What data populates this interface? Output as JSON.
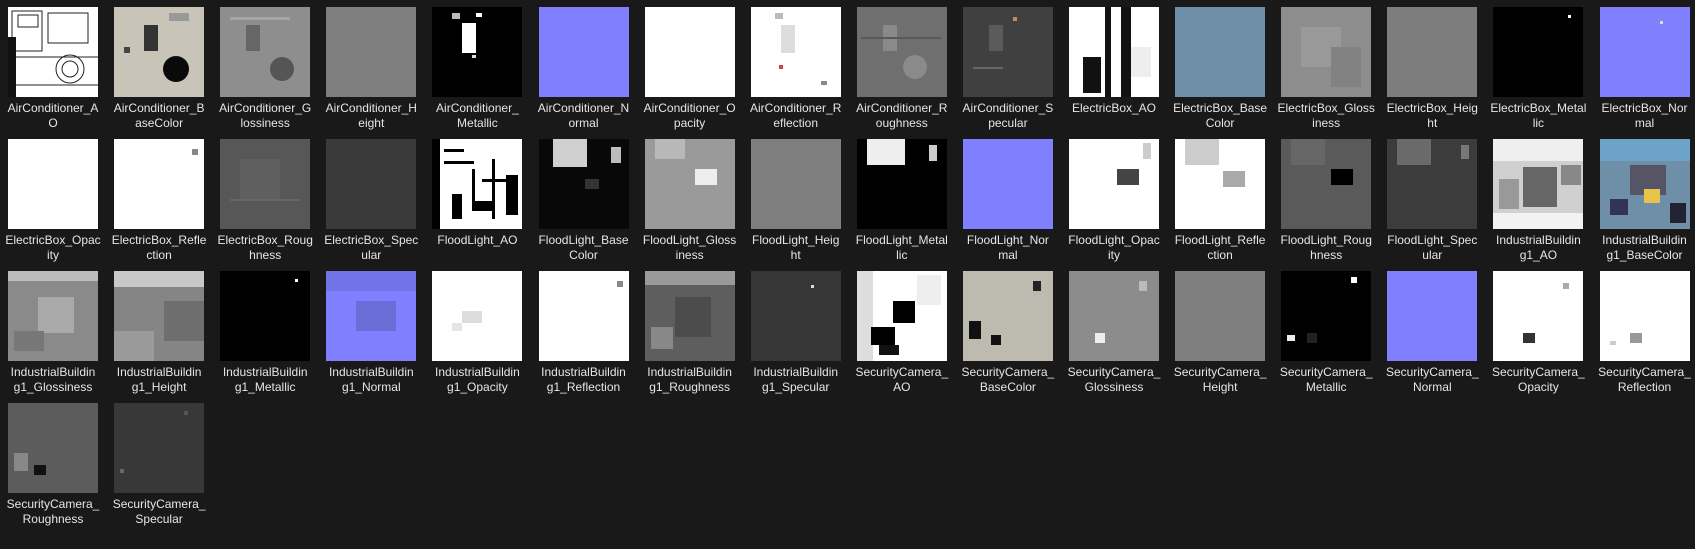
{
  "files": [
    {
      "label": "AirConditioner_A\nO",
      "icon": "texture-ao-icon",
      "bg": "#ffffff",
      "pat": "ao"
    },
    {
      "label": "AirConditioner_B\naseColor",
      "icon": "texture-basecolor-icon",
      "bg": "#c9c4b8",
      "pat": "ac-base"
    },
    {
      "label": "AirConditioner_G\nlossiness",
      "icon": "texture-glossiness-icon",
      "bg": "#8e8e8e",
      "pat": "ac-gloss"
    },
    {
      "label": "AirConditioner_H\neight",
      "icon": "texture-height-icon",
      "bg": "#7e7e7e",
      "pat": "flat"
    },
    {
      "label": "AirConditioner_\nMetallic",
      "icon": "texture-metallic-icon",
      "bg": "#000000",
      "pat": "ac-metal"
    },
    {
      "label": "AirConditioner_N\normal",
      "icon": "texture-normal-icon",
      "bg": "#8080ff",
      "pat": "flat"
    },
    {
      "label": "AirConditioner_O\npacity",
      "icon": "texture-opacity-icon",
      "bg": "#ffffff",
      "pat": "flat"
    },
    {
      "label": "AirConditioner_R\neflection",
      "icon": "texture-reflection-icon",
      "bg": "#ffffff",
      "pat": "ac-refl"
    },
    {
      "label": "AirConditioner_R\noughness",
      "icon": "texture-roughness-icon",
      "bg": "#6f6f6f",
      "pat": "ac-rough"
    },
    {
      "label": "AirConditioner_S\npecular",
      "icon": "texture-specular-icon",
      "bg": "#404040",
      "pat": "ac-spec"
    },
    {
      "label": "ElectricBox_AO",
      "icon": "texture-ao-icon",
      "bg": "#ffffff",
      "pat": "eb-ao"
    },
    {
      "label": "ElectricBox_Base\nColor",
      "icon": "texture-basecolor-icon",
      "bg": "#6d8ea6",
      "pat": "flat"
    },
    {
      "label": "ElectricBox_Gloss\niness",
      "icon": "texture-glossiness-icon",
      "bg": "#8d8d8d",
      "pat": "eb-gloss"
    },
    {
      "label": "ElectricBox_Heig\nht",
      "icon": "texture-height-icon",
      "bg": "#7d7d7d",
      "pat": "flat"
    },
    {
      "label": "ElectricBox_Metal\nlic",
      "icon": "texture-metallic-icon",
      "bg": "#000000",
      "pat": "dot"
    },
    {
      "label": "ElectricBox_Nor\nmal",
      "icon": "texture-normal-icon",
      "bg": "#8080ff",
      "pat": "dot-light"
    },
    {
      "label": "ElectricBox_Opac\nity",
      "icon": "texture-opacity-icon",
      "bg": "#ffffff",
      "pat": "flat"
    },
    {
      "label": "ElectricBox_Refle\nction",
      "icon": "texture-reflection-icon",
      "bg": "#ffffff",
      "pat": "dot-gray"
    },
    {
      "label": "ElectricBox_Roug\nhness",
      "icon": "texture-roughness-icon",
      "bg": "#575757",
      "pat": "eb-rough"
    },
    {
      "label": "ElectricBox_Spec\nular",
      "icon": "texture-specular-icon",
      "bg": "#3a3a3a",
      "pat": "flat"
    },
    {
      "label": "FloodLight_AO",
      "icon": "texture-ao-icon",
      "bg": "#ffffff",
      "pat": "fl-ao"
    },
    {
      "label": "FloodLight_Base\nColor",
      "icon": "texture-basecolor-icon",
      "bg": "#080808",
      "pat": "fl-base"
    },
    {
      "label": "FloodLight_Gloss\niness",
      "icon": "texture-glossiness-icon",
      "bg": "#9a9a9a",
      "pat": "fl-gloss"
    },
    {
      "label": "FloodLight_Heig\nht",
      "icon": "texture-height-icon",
      "bg": "#7e7e7e",
      "pat": "flat"
    },
    {
      "label": "FloodLight_Metal\nlic",
      "icon": "texture-metallic-icon",
      "bg": "#000000",
      "pat": "fl-metal"
    },
    {
      "label": "FloodLight_Nor\nmal",
      "icon": "texture-normal-icon",
      "bg": "#8080ff",
      "pat": "flat"
    },
    {
      "label": "FloodLight_Opac\nity",
      "icon": "texture-opacity-icon",
      "bg": "#ffffff",
      "pat": "fl-opac"
    },
    {
      "label": "FloodLight_Refle\nction",
      "icon": "texture-reflection-icon",
      "bg": "#ffffff",
      "pat": "fl-refl"
    },
    {
      "label": "FloodLight_Roug\nhness",
      "icon": "texture-roughness-icon",
      "bg": "#5a5a5a",
      "pat": "fl-rough"
    },
    {
      "label": "FloodLight_Spec\nular",
      "icon": "texture-specular-icon",
      "bg": "#3c3c3c",
      "pat": "fl-spec"
    },
    {
      "label": "IndustrialBuildin\ng1_AO",
      "icon": "texture-ao-icon",
      "bg": "#d0d0d0",
      "pat": "ib-ao"
    },
    {
      "label": "IndustrialBuildin\ng1_BaseColor",
      "icon": "texture-basecolor-icon",
      "bg": "#6f8fa8",
      "pat": "ib-base"
    },
    {
      "label": "IndustrialBuildin\ng1_Glossiness",
      "icon": "texture-glossiness-icon",
      "bg": "#8a8a8a",
      "pat": "ib-gloss"
    },
    {
      "label": "IndustrialBuildin\ng1_Height",
      "icon": "texture-height-icon",
      "bg": "#858585",
      "pat": "ib-height"
    },
    {
      "label": "IndustrialBuildin\ng1_Metallic",
      "icon": "texture-metallic-icon",
      "bg": "#000000",
      "pat": "dot"
    },
    {
      "label": "IndustrialBuildin\ng1_Normal",
      "icon": "texture-normal-icon",
      "bg": "#7f7fff",
      "pat": "ib-normal"
    },
    {
      "label": "IndustrialBuildin\ng1_Opacity",
      "icon": "texture-opacity-icon",
      "bg": "#ffffff",
      "pat": "ib-opac"
    },
    {
      "label": "IndustrialBuildin\ng1_Reflection",
      "icon": "texture-reflection-icon",
      "bg": "#ffffff",
      "pat": "dot-gray"
    },
    {
      "label": "IndustrialBuildin\ng1_Roughness",
      "icon": "texture-roughness-icon",
      "bg": "#5e5e5e",
      "pat": "ib-rough"
    },
    {
      "label": "IndustrialBuildin\ng1_Specular",
      "icon": "texture-specular-icon",
      "bg": "#363636",
      "pat": "dot-light"
    },
    {
      "label": "SecurityCamera_\nAO",
      "icon": "texture-ao-icon",
      "bg": "#ffffff",
      "pat": "sc-ao"
    },
    {
      "label": "SecurityCamera_\nBaseColor",
      "icon": "texture-basecolor-icon",
      "bg": "#bdbab0",
      "pat": "sc-base"
    },
    {
      "label": "SecurityCamera_\nGlossiness",
      "icon": "texture-glossiness-icon",
      "bg": "#8c8c8c",
      "pat": "sc-gloss"
    },
    {
      "label": "SecurityCamera_\nHeight",
      "icon": "texture-height-icon",
      "bg": "#7e7e7e",
      "pat": "flat"
    },
    {
      "label": "SecurityCamera_\nMetallic",
      "icon": "texture-metallic-icon",
      "bg": "#000000",
      "pat": "sc-metal"
    },
    {
      "label": "SecurityCamera_\nNormal",
      "icon": "texture-normal-icon",
      "bg": "#8080ff",
      "pat": "flat"
    },
    {
      "label": "SecurityCamera_\nOpacity",
      "icon": "texture-opacity-icon",
      "bg": "#ffffff",
      "pat": "sc-opac"
    },
    {
      "label": "SecurityCamera_\nReflection",
      "icon": "texture-reflection-icon",
      "bg": "#ffffff",
      "pat": "sc-refl"
    },
    {
      "label": "SecurityCamera_\nRoughness",
      "icon": "texture-roughness-icon",
      "bg": "#5c5c5c",
      "pat": "sc-rough"
    },
    {
      "label": "SecurityCamera_\nSpecular",
      "icon": "texture-specular-icon",
      "bg": "#383838",
      "pat": "sc-spec"
    }
  ]
}
